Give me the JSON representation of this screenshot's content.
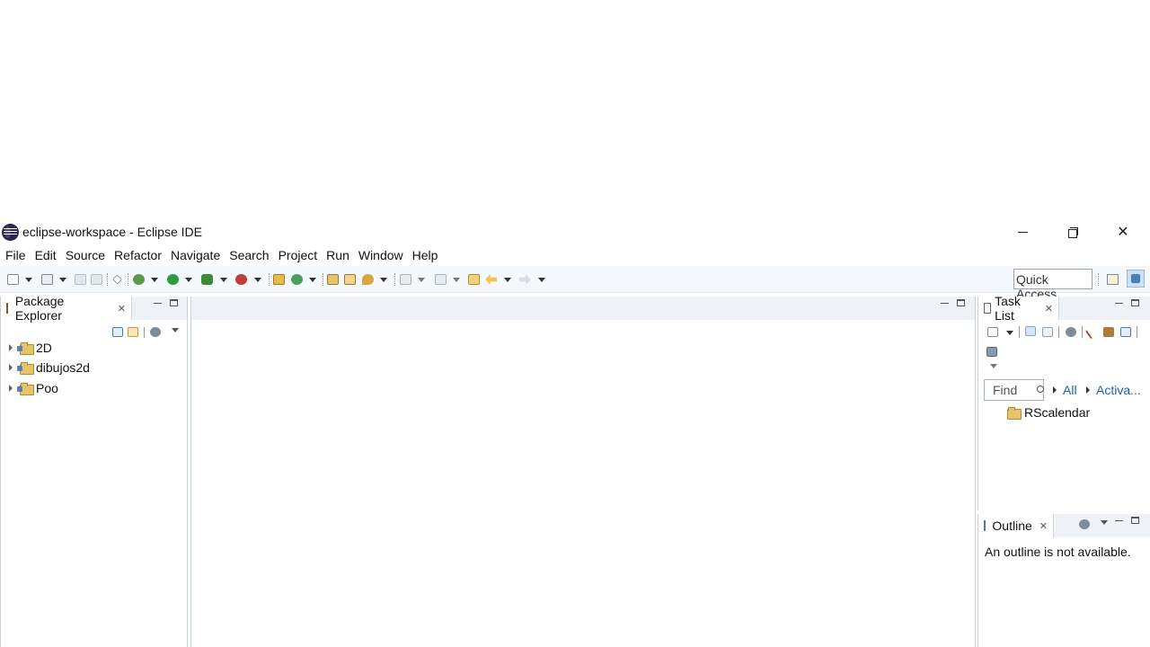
{
  "window": {
    "title": "eclipse-workspace - Eclipse IDE",
    "app_icon": "eclipse-logo-icon"
  },
  "menubar": {
    "items": [
      "File",
      "Edit",
      "Source",
      "Refactor",
      "Navigate",
      "Search",
      "Project",
      "Run",
      "Window",
      "Help"
    ]
  },
  "toolbar": {
    "quick_access_label": "Quick Access",
    "buttons": [
      "new-icon",
      "save-icon",
      "save-all-icon",
      "skip-breakpoints-icon",
      "debug-icon",
      "run-icon",
      "coverage-icon",
      "external-tools-icon",
      "new-java-package-icon",
      "new-java-class-icon",
      "open-type-icon",
      "open-task-icon",
      "search-icon",
      "next-annotation-icon",
      "previous-annotation-icon",
      "last-edit-location-icon",
      "back-icon",
      "forward-icon"
    ],
    "perspectives": [
      "open-perspective-icon",
      "java-perspective-icon"
    ]
  },
  "package_explorer": {
    "title": "Package Explorer",
    "projects": [
      "2D",
      "dibujos2d",
      "Poo"
    ]
  },
  "task_list": {
    "title": "Task List",
    "find_placeholder": "Find",
    "all_label": "All",
    "activate_label": "Activa...",
    "category": "RScalendar"
  },
  "outline": {
    "title": "Outline",
    "message": "An outline is not available."
  },
  "colors": {
    "accent": "#1f5fb3",
    "tab_strip": "#eef2f7",
    "toolbar_bg": "#f4f7fb"
  }
}
